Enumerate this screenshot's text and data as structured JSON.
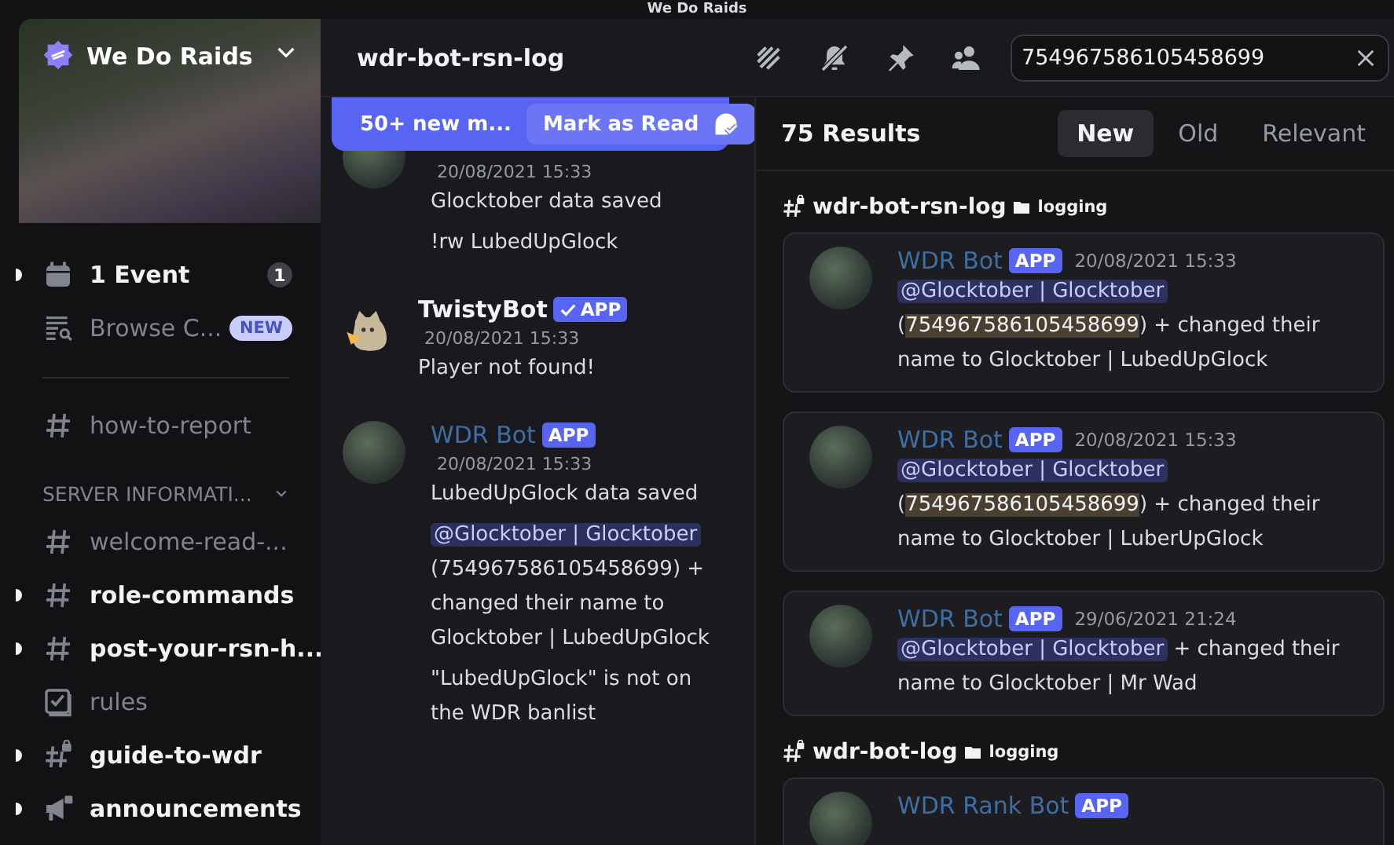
{
  "title_bar": {
    "title": "We Do Raids"
  },
  "server": {
    "name": "We Do Raids"
  },
  "sidebar": {
    "items": [
      {
        "kind": "event",
        "label": "1 Event",
        "badge": "1",
        "unread": true
      },
      {
        "kind": "browse",
        "label": "Browse C...",
        "badge": "NEW",
        "unread": false
      },
      {
        "kind": "divider"
      },
      {
        "kind": "channel",
        "label": "how-to-report",
        "unread": false
      },
      {
        "kind": "category",
        "label": "SERVER INFORMATI..."
      },
      {
        "kind": "channel",
        "label": "welcome-read-...",
        "unread": false
      },
      {
        "kind": "channel",
        "label": "role-commands",
        "unread": true
      },
      {
        "kind": "channel",
        "label": "post-your-rsn-h...",
        "unread": true
      },
      {
        "kind": "rules",
        "label": "rules",
        "unread": false
      },
      {
        "kind": "locked",
        "label": "guide-to-wdr",
        "unread": true
      },
      {
        "kind": "announcement",
        "label": "announcements",
        "unread": true
      }
    ]
  },
  "header": {
    "channel": "wdr-bot-rsn-log",
    "search": {
      "value": "754967586105458699"
    }
  },
  "chat": {
    "banner": {
      "text": "50+ new m...",
      "action": "Mark as Read"
    },
    "messages": [
      {
        "kind": "emblem",
        "time": "20/08/2021 15:33",
        "paragraphs": [
          [
            {
              "kind": "text",
              "text": "Glocktober data saved"
            }
          ],
          [
            {
              "kind": "text",
              "text": "!rw LubedUpGlock"
            }
          ]
        ]
      },
      {
        "kind": "cat",
        "author": "TwistyBot",
        "color": "#f2f3f5",
        "tag": "APP",
        "verified": true,
        "time": "20/08/2021 15:33",
        "paragraphs": [
          [
            {
              "kind": "text",
              "text": "Player not found!"
            }
          ]
        ]
      },
      {
        "kind": "emblem",
        "author": "WDR Bot",
        "color": "#3d6fa3",
        "tag": "APP",
        "verified": false,
        "time": "20/08/2021 15:33",
        "paragraphs": [
          [
            {
              "kind": "text",
              "text": "LubedUpGlock data saved"
            }
          ],
          [
            {
              "kind": "mention",
              "text": "@Glocktober | Glocktober"
            },
            {
              "kind": "text",
              "text": " (754967586105458699) + changed their name to Glocktober | LubedUpGlock"
            }
          ],
          [
            {
              "kind": "text",
              "text": "\"LubedUpGlock\" is not on the WDR banlist"
            }
          ]
        ]
      }
    ]
  },
  "results": {
    "count": "75 Results",
    "sort_tabs": [
      {
        "label": "New",
        "selected": true
      },
      {
        "label": "Old",
        "selected": false
      },
      {
        "label": "Relevant",
        "selected": false
      }
    ],
    "groups": [
      {
        "channel": "wdr-bot-rsn-log",
        "category": "logging",
        "results": [
          {
            "author": "WDR Bot",
            "color": "#3d6fa3",
            "tag": "APP",
            "time": "20/08/2021 15:33",
            "parts": [
              {
                "kind": "mention",
                "text": "@Glocktober | Glocktober"
              },
              {
                "kind": "text",
                "text": " ("
              },
              {
                "kind": "highlight",
                "text": "754967586105458699"
              },
              {
                "kind": "text",
                "text": ") + changed their name to Glocktober | LubedUpGlock"
              }
            ]
          },
          {
            "author": "WDR Bot",
            "color": "#3d6fa3",
            "tag": "APP",
            "time": "20/08/2021 15:33",
            "parts": [
              {
                "kind": "mention",
                "text": "@Glocktober | Glocktober"
              },
              {
                "kind": "text",
                "text": " ("
              },
              {
                "kind": "highlight",
                "text": "754967586105458699"
              },
              {
                "kind": "text",
                "text": ") + changed their name to Glocktober | LuberUpGlock"
              }
            ]
          },
          {
            "author": "WDR Bot",
            "color": "#3d6fa3",
            "tag": "APP",
            "time": "29/06/2021 21:24",
            "parts": [
              {
                "kind": "mention",
                "text": "@Glocktober | Glocktober"
              },
              {
                "kind": "text",
                "text": " + changed their name to Glocktober | Mr Wad"
              }
            ]
          }
        ]
      },
      {
        "channel": "wdr-bot-log",
        "category": "logging",
        "results": [
          {
            "author": "WDR Rank Bot",
            "color": "#3d6fa3",
            "tag": "APP"
          }
        ]
      }
    ]
  }
}
